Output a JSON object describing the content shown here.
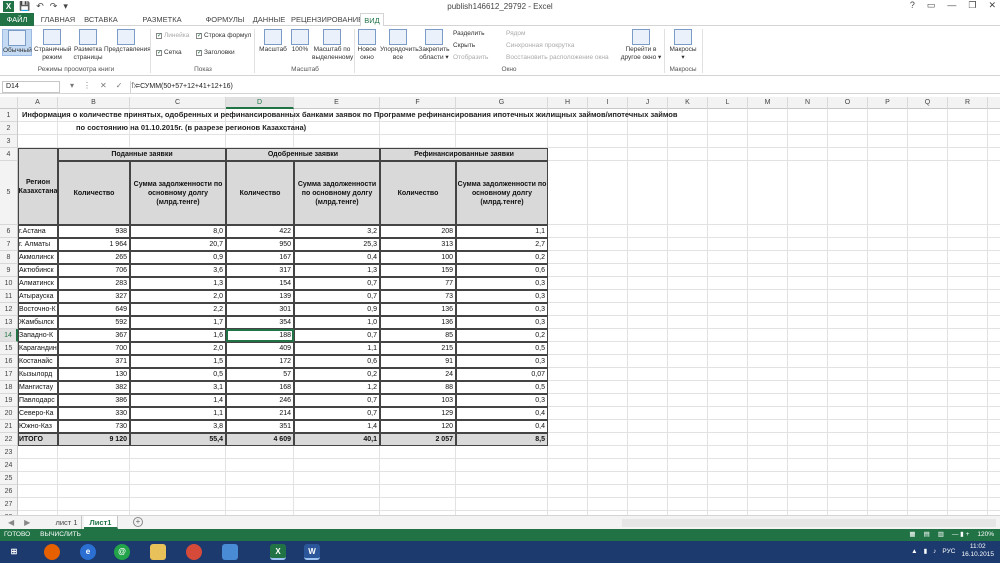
{
  "window": {
    "title": "publish146612_29792 - Excel",
    "app_icon": "X",
    "qat": [
      "💾",
      "↶",
      "↷",
      "▾"
    ],
    "controls": [
      "?",
      "▭",
      "—",
      "❐",
      "✕"
    ]
  },
  "ribbon_tabs": [
    {
      "label": "ФАЙЛ"
    },
    {
      "label": "ГЛАВНАЯ"
    },
    {
      "label": "ВСТАВКА"
    },
    {
      "label": "РАЗМЕТКА СТРАНИЦЫ"
    },
    {
      "label": "ФОРМУЛЫ"
    },
    {
      "label": "ДАННЫЕ"
    },
    {
      "label": "РЕЦЕНЗИРОВАНИЕ"
    },
    {
      "label": "ВИД"
    }
  ],
  "ribbon": {
    "views": [
      {
        "label": "Обычный"
      },
      {
        "label": "Страничный режим"
      },
      {
        "label": "Разметка страницы"
      },
      {
        "label": "Представления"
      }
    ],
    "views_group": "Режимы просмотра книги",
    "show": {
      "ruler": "Линейка",
      "formula_bar": "Строка формул",
      "gridlines": "Сетка",
      "headings": "Заголовки"
    },
    "show_group": "Показ",
    "zoom": {
      "zoom": "Масштаб",
      "hundred": "100%",
      "zoom_selection": "Масштаб по выделенному"
    },
    "zoom_group": "Масштаб",
    "window_btns": {
      "new_window": "Новое окно",
      "arrange": "Упорядочить все",
      "freeze": "Закрепить области ▾"
    },
    "window_small": {
      "split": "Разделить",
      "hide": "Скрыть",
      "unhide": "Отобразить",
      "side_by_side": "Рядом",
      "sync_scroll": "Синхронная прокрутка",
      "reset_pos": "Восстановить расположение окна"
    },
    "window_group": "Окно",
    "switch": "Перейти в другое окно ▾",
    "macros": "Макросы ▾",
    "macros_group": "Макросы"
  },
  "formula_bar": {
    "cell_ref": "D14",
    "formula": "=СУММ(50+57+12+41+12+16)",
    "icons": [
      "▾",
      "⋮",
      "✕",
      "✓",
      "fx"
    ]
  },
  "columns": [
    "A",
    "B",
    "C",
    "D",
    "E",
    "F",
    "G",
    "H",
    "I",
    "J",
    "K",
    "L",
    "M",
    "N",
    "O",
    "P",
    "Q",
    "R"
  ],
  "rows": [
    "1",
    "2",
    "3",
    "4",
    "5",
    "6",
    "7",
    "8",
    "9",
    "10",
    "11",
    "12",
    "13",
    "14",
    "15",
    "16",
    "17",
    "18",
    "19",
    "20",
    "21",
    "22",
    "23",
    "24",
    "25",
    "26",
    "27",
    "28",
    "29"
  ],
  "sheet": {
    "title1": "Информация о количестве принятых, одобренных и рефинансированных банками заявок по Программе рефинансирования ипотечных жилищных займов/ипотечных займов",
    "title2": "по состоянию на 01.10.2015г. (в разрезе регионов Казахстана)",
    "h_region": "Регион Казахстана",
    "h_submitted": "Поданные заявки",
    "h_approved": "Одобренные заявки",
    "h_refinanced": "Рефинансированные заявки",
    "h_count": "Количество",
    "h_debt1": "Сумма задолженности по основному долгу (млрд.тенге)",
    "h_debt2": "Сумма задолженности по основному долгу (млрд.тенге)",
    "h_debt3": "Сумма задолженности по основному долгу (млрд.тенге)",
    "data": [
      [
        "г.Астана",
        "938",
        "8,0",
        "422",
        "3,2",
        "208",
        "1,1"
      ],
      [
        "г. Алматы",
        "1 964",
        "20,7",
        "950",
        "25,3",
        "313",
        "2,7"
      ],
      [
        "Акмолинск",
        "265",
        "0,9",
        "167",
        "0,4",
        "100",
        "0,2"
      ],
      [
        "Актюбинск",
        "706",
        "3,6",
        "317",
        "1,3",
        "159",
        "0,6"
      ],
      [
        "Алматинск",
        "283",
        "1,3",
        "154",
        "0,7",
        "77",
        "0,3"
      ],
      [
        "Атырауска",
        "327",
        "2,0",
        "139",
        "0,7",
        "73",
        "0,3"
      ],
      [
        "Восточно-К",
        "649",
        "2,2",
        "301",
        "0,9",
        "136",
        "0,3"
      ],
      [
        "Жамбылск",
        "592",
        "1,7",
        "354",
        "1,0",
        "136",
        "0,3"
      ],
      [
        "Западно-К",
        "367",
        "1,6",
        "188",
        "0,7",
        "85",
        "0,2"
      ],
      [
        "Карагандин",
        "700",
        "2,0",
        "409",
        "1,1",
        "215",
        "0,5"
      ],
      [
        "Костанайс",
        "371",
        "1,5",
        "172",
        "0,6",
        "91",
        "0,3"
      ],
      [
        "Кызылорд",
        "130",
        "0,5",
        "57",
        "0,2",
        "24",
        "0,07"
      ],
      [
        "Мангистау",
        "382",
        "3,1",
        "168",
        "1,2",
        "88",
        "0,5"
      ],
      [
        "Павлодарс",
        "386",
        "1,4",
        "246",
        "0,7",
        "103",
        "0,3"
      ],
      [
        "Северо-Ка",
        "330",
        "1,1",
        "214",
        "0,7",
        "129",
        "0,4"
      ],
      [
        "Южно-Каз",
        "730",
        "3,8",
        "351",
        "1,4",
        "120",
        "0,4"
      ]
    ],
    "total": [
      "ИТОГО",
      "9 120",
      "55,4",
      "4 609",
      "40,1",
      "2 057",
      "8,5"
    ]
  },
  "sheet_tabs": [
    {
      "label": "лист 1"
    },
    {
      "label": "Лист1"
    }
  ],
  "status": {
    "ready": "ГОТОВО",
    "enter": "ВЫЧИСЛИТЬ",
    "zoom": "120%"
  },
  "taskbar": {
    "lang": "РУС",
    "time": "11:02",
    "date": "16.10.2015",
    "icons": [
      "start-icon",
      "firefox-icon",
      "ie-icon",
      "at-icon",
      "folder-icon",
      "chrome-icon",
      "photos-icon",
      "excel-icon",
      "word-icon"
    ]
  },
  "colors": {
    "excel_green": "#217346",
    "header_gray": "#d9d9d9",
    "taskbar": "#1c3a6d"
  }
}
